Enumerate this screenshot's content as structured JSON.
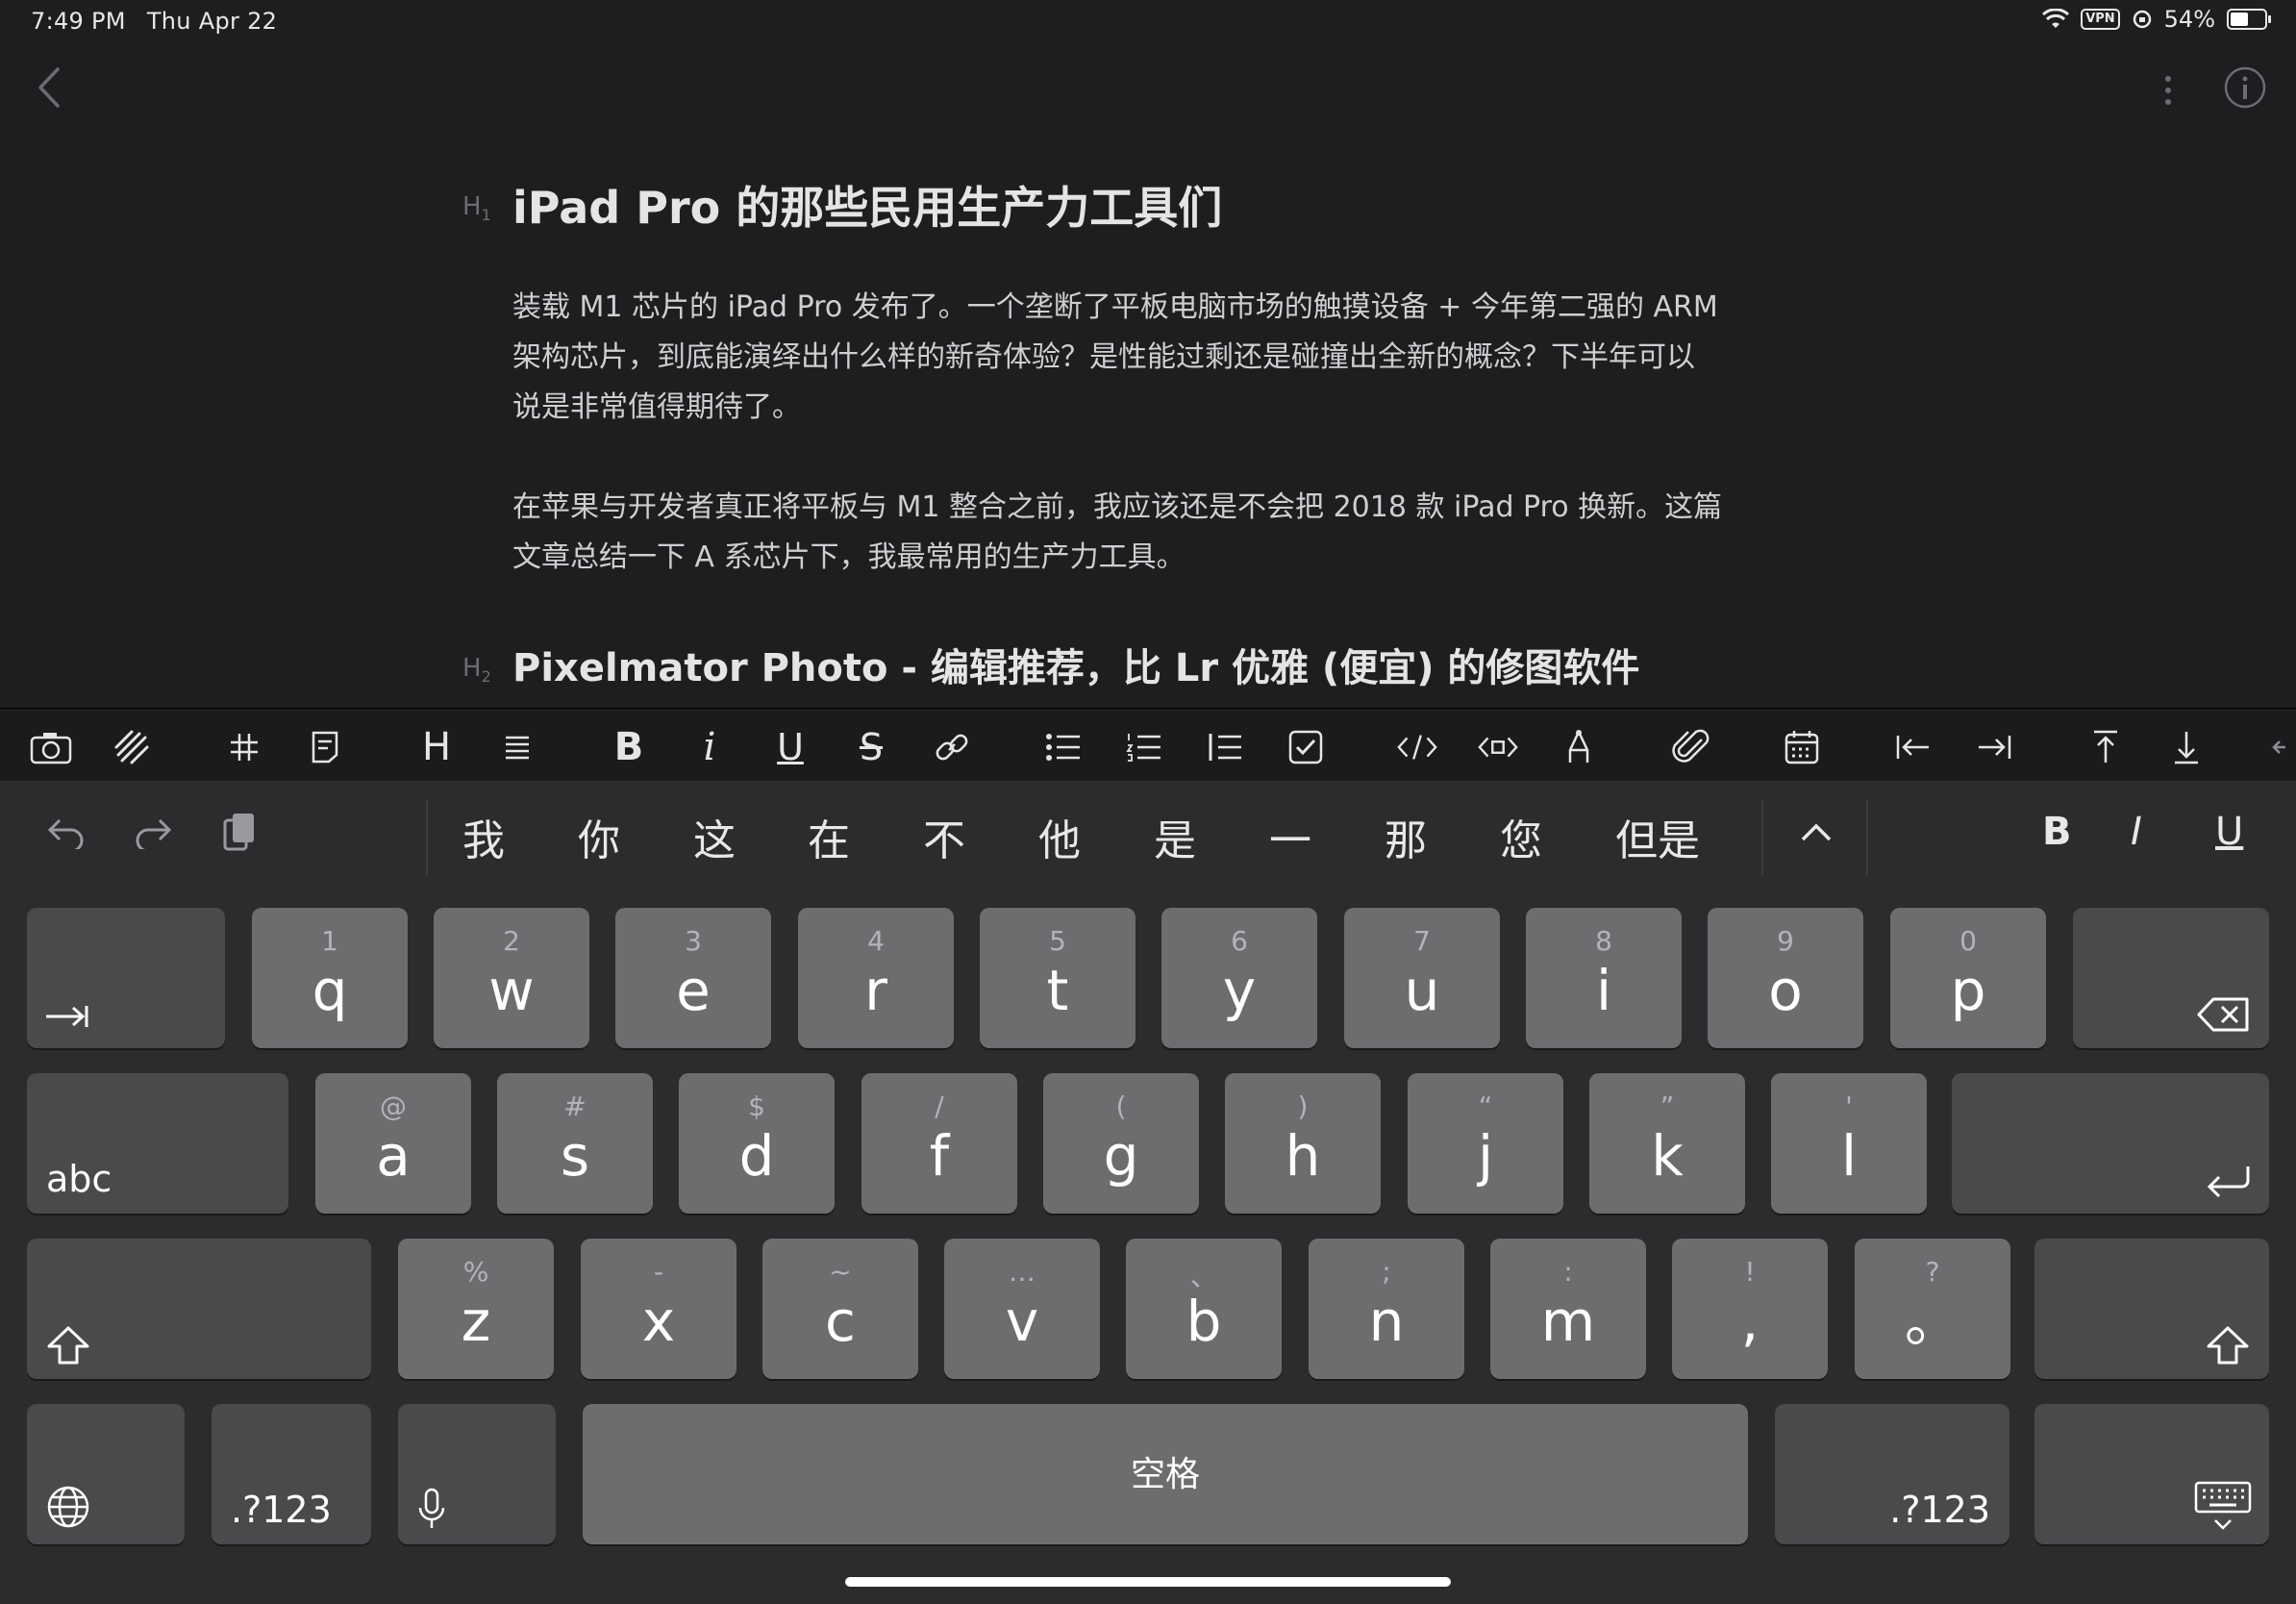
{
  "status": {
    "time": "7:49 PM",
    "date": "Thu Apr 22",
    "vpn": "VPN",
    "battery_text": "54%",
    "battery_level": 0.54
  },
  "document": {
    "h1_marker": "H",
    "h1_level": "1",
    "h1": "iPad Pro 的那些民用生产力工具们",
    "p1_l1": "装载 M1 芯片的 iPad Pro 发布了。一个垄断了平板电脑市场的触摸设备 + 今年第二强的 ARM",
    "p1_l2": "架构芯片，到底能演绎出什么样的新奇体验？是性能过剩还是碰撞出全新的概念？下半年可以",
    "p1_l3": "说是非常值得期待了。",
    "p2_l1": "在苹果与开发者真正将平板与 M1 整合之前，我应该还是不会把 2018 款 iPad Pro 换新。这篇",
    "p2_l2": "文章总结一下 A 系芯片下，我最常用的生产力工具。",
    "h2_marker": "H",
    "h2_level": "2",
    "h2": "Pixelmator Photo - 编辑推荐，比 Lr 优雅 (便宜) 的修图软件"
  },
  "format_toolbar": {
    "heading": "H",
    "bold": "B",
    "italic": "i",
    "underline": "U",
    "strike": "S"
  },
  "candidates": [
    "我",
    "你",
    "这",
    "在",
    "不",
    "他",
    "是",
    "一",
    "那",
    "您",
    "但是"
  ],
  "style_buttons": {
    "bold": "B",
    "italic": "I",
    "underline": "U"
  },
  "keyboard": {
    "row1": [
      {
        "s": "1",
        "m": "q"
      },
      {
        "s": "2",
        "m": "w"
      },
      {
        "s": "3",
        "m": "e"
      },
      {
        "s": "4",
        "m": "r"
      },
      {
        "s": "5",
        "m": "t"
      },
      {
        "s": "6",
        "m": "y"
      },
      {
        "s": "7",
        "m": "u"
      },
      {
        "s": "8",
        "m": "i"
      },
      {
        "s": "9",
        "m": "o"
      },
      {
        "s": "0",
        "m": "p"
      }
    ],
    "row2": [
      {
        "s": "@",
        "m": "a"
      },
      {
        "s": "#",
        "m": "s"
      },
      {
        "s": "$",
        "m": "d"
      },
      {
        "s": "/",
        "m": "f"
      },
      {
        "s": "(",
        "m": "g"
      },
      {
        "s": ")",
        "m": "h"
      },
      {
        "s": "“",
        "m": "j"
      },
      {
        "s": "”",
        "m": "k"
      },
      {
        "s": "'",
        "m": "l"
      }
    ],
    "row3": [
      {
        "s": "%",
        "m": "z"
      },
      {
        "s": "-",
        "m": "x"
      },
      {
        "s": "~",
        "m": "c"
      },
      {
        "s": "…",
        "m": "v"
      },
      {
        "s": "、",
        "m": "b"
      },
      {
        "s": ";",
        "m": "n"
      },
      {
        "s": ":",
        "m": "m"
      },
      {
        "s": "!",
        "m": ","
      },
      {
        "s": "?",
        "m": "。"
      }
    ],
    "abc_label": "abc",
    "num_label": ".?123",
    "space_label": "空格"
  }
}
